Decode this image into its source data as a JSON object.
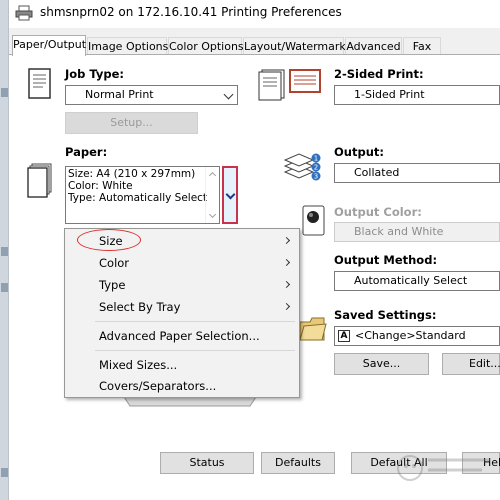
{
  "window": {
    "title": "shmsnprn02 on 172.16.10.41 Printing Preferences"
  },
  "tabs": [
    "Paper/Output",
    "Image Options",
    "Color Options",
    "Layout/Watermark",
    "Advanced",
    "Fax"
  ],
  "active_tab": "Paper/Output",
  "job_type": {
    "label": "Job Type:",
    "value": "Normal Print",
    "setup_button": "Setup..."
  },
  "paper": {
    "label": "Paper:",
    "lines": [
      "Size: A4 (210 x 297mm)",
      "Color: White",
      "Type: Automatically Select"
    ]
  },
  "paper_menu": {
    "items": [
      {
        "label": "Size",
        "submenu": true,
        "highlighted_circle": true
      },
      {
        "label": "Color",
        "submenu": true
      },
      {
        "label": "Type",
        "submenu": true
      },
      {
        "label": "Select By Tray",
        "submenu": true
      },
      {
        "label": "Advanced Paper Selection...",
        "submenu": false
      },
      {
        "label": "Mixed Sizes...",
        "submenu": false
      },
      {
        "label": "Covers/Separators...",
        "submenu": false
      }
    ]
  },
  "two_sided": {
    "label": "2-Sided Print:",
    "value": "1-Sided Print"
  },
  "output": {
    "label": "Output:",
    "value": "Collated"
  },
  "output_color": {
    "label": "Output Color:",
    "value": "Black and White",
    "disabled": true
  },
  "output_method": {
    "label": "Output Method:",
    "value": "Automatically Select"
  },
  "saved_settings": {
    "label": "Saved Settings:",
    "icon_letter": "A",
    "value": "<Change>Standard",
    "save_button": "Save...",
    "edit_button": "Edit..."
  },
  "bottom_buttons": {
    "status": "Status",
    "defaults": "Defaults",
    "default_all": "Default All",
    "help": "Help"
  },
  "icons": {
    "job_type": "document-icon",
    "paper": "paper-stack-icon",
    "two_sided": "two-sided-pages-icon",
    "output": "collated-stack-icon",
    "output_color": "color-toner-icon",
    "saved": "folder-icon"
  }
}
